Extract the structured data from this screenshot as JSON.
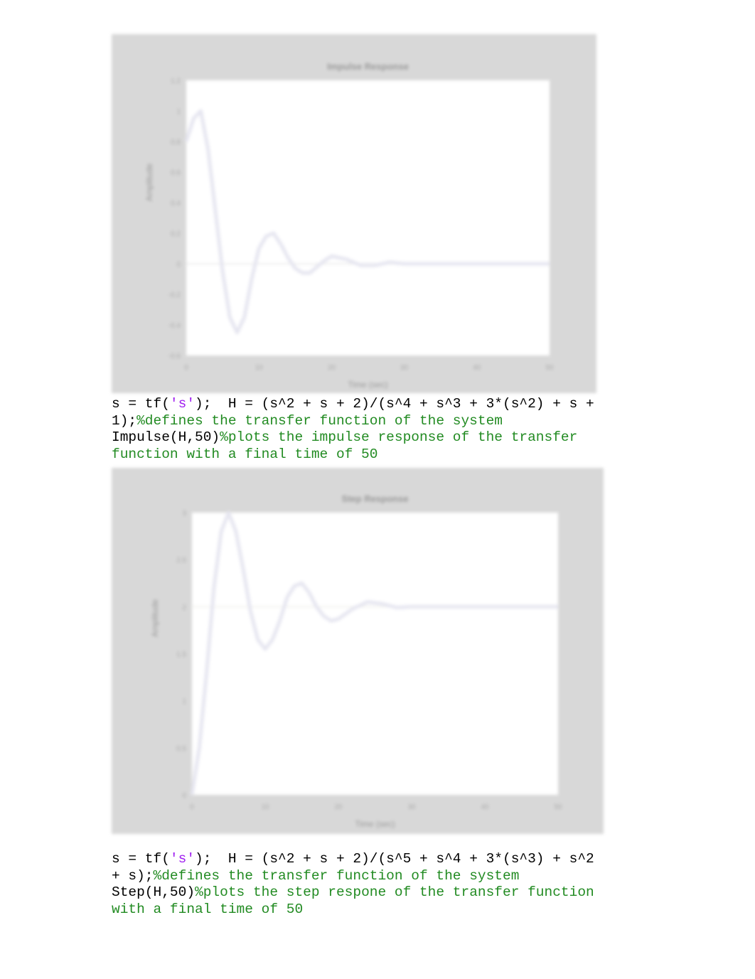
{
  "chart_data": [
    {
      "type": "line",
      "title": "Impulse Response",
      "xlabel": "Time (sec)",
      "ylabel": "Amplitude",
      "xlim": [
        0,
        50
      ],
      "ylim": [
        -0.6,
        1.2
      ],
      "xticks": [
        "0",
        "10",
        "20",
        "30",
        "40",
        "50"
      ],
      "yticks": [
        "-0.6",
        "-0.4",
        "-0.2",
        "0",
        "0.2",
        "0.4",
        "0.6",
        "0.8",
        "1",
        "1.2"
      ],
      "x": [
        0,
        1,
        2,
        3,
        4,
        5,
        6,
        7,
        8,
        9,
        10,
        11,
        12,
        13,
        14,
        15,
        16,
        17,
        18,
        19,
        20,
        22,
        24,
        26,
        28,
        30,
        35,
        40,
        45,
        50
      ],
      "y": [
        0.8,
        0.95,
        1.0,
        0.75,
        0.35,
        -0.05,
        -0.35,
        -0.45,
        -0.35,
        -0.1,
        0.1,
        0.18,
        0.2,
        0.13,
        0.04,
        -0.03,
        -0.06,
        -0.06,
        -0.02,
        0.02,
        0.05,
        0.03,
        -0.01,
        -0.01,
        0.01,
        0.0,
        0.0,
        0.0,
        0.0,
        0.0
      ],
      "grid": false,
      "line_color": "#e6e6f0",
      "background": "#d8d8d8"
    },
    {
      "type": "line",
      "title": "Step Response",
      "xlabel": "Time (sec)",
      "ylabel": "Amplitude",
      "xlim": [
        0,
        50
      ],
      "ylim": [
        0,
        3
      ],
      "xticks": [
        "0",
        "10",
        "20",
        "30",
        "40",
        "50"
      ],
      "yticks": [
        "0",
        "0.5",
        "1",
        "1.5",
        "2",
        "2.5",
        "3"
      ],
      "x": [
        0,
        1,
        2,
        3,
        4,
        5,
        6,
        7,
        8,
        9,
        10,
        11,
        12,
        13,
        14,
        15,
        16,
        17,
        18,
        19,
        20,
        22,
        24,
        26,
        28,
        30,
        35,
        40,
        45,
        50
      ],
      "y": [
        0,
        0.5,
        1.3,
        2.2,
        2.8,
        3.0,
        2.8,
        2.4,
        1.95,
        1.65,
        1.55,
        1.65,
        1.85,
        2.1,
        2.22,
        2.25,
        2.15,
        2.0,
        1.9,
        1.85,
        1.87,
        1.98,
        2.05,
        2.03,
        1.99,
        2.0,
        2.0,
        2.0,
        2.0,
        2.0
      ],
      "grid": false,
      "line_color": "#e6e6f0",
      "background": "#d8d8d8"
    }
  ],
  "code1": {
    "line1": "s = tf(",
    "str1": "'s'",
    "line1b": ");  H = (s^2 + s + 2)/(s^4 + s^3 + 3*(s^2) + s +",
    "line2": "1);",
    "comment1": "%defines the transfer function of the system",
    "line3": "Impulse(H,50)",
    "comment2": "%plots the impulse response of the transfer",
    "comment2b": "function with a final time of 50"
  },
  "code2": {
    "line1": "s = tf(",
    "str1": "'s'",
    "line1b": ");  H = (s^2 + s + 2)/(s^5 + s^4 + 3*(s^3) + s^2",
    "line2": "+ s);",
    "comment1": "%defines the transfer function of the system",
    "line3": "Step(H,50)",
    "comment2": "%plots the step respone of the transfer function",
    "comment2b": "with a final time of 50"
  }
}
